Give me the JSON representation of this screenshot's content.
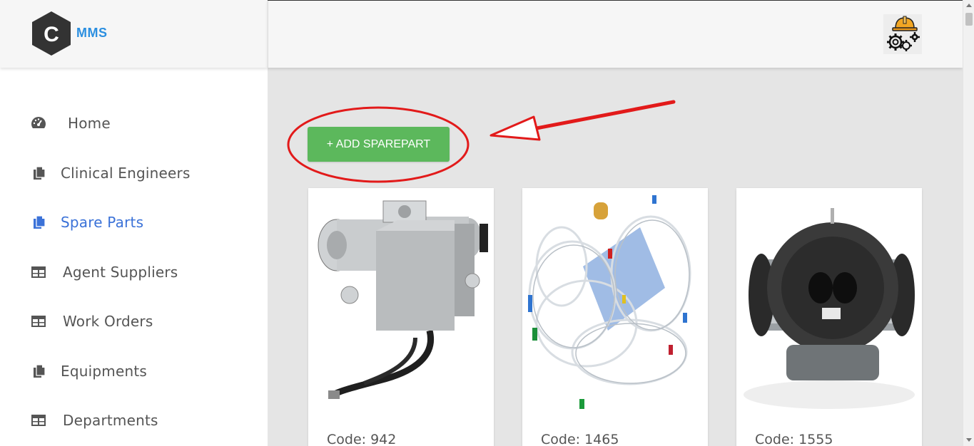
{
  "brand": {
    "text": "MMS",
    "logo_icon": "hexagon-c-logo"
  },
  "sidebar": {
    "items": [
      {
        "label": "Home",
        "icon": "dashboard-icon",
        "active": false
      },
      {
        "label": "Clinical Engineers",
        "icon": "files-icon",
        "active": false
      },
      {
        "label": "Spare Parts",
        "icon": "files-icon",
        "active": true
      },
      {
        "label": "Agent Suppliers",
        "icon": "table-icon",
        "active": false
      },
      {
        "label": "Work Orders",
        "icon": "table-icon",
        "active": false
      },
      {
        "label": "Equipments",
        "icon": "files-icon",
        "active": false
      },
      {
        "label": "Departments",
        "icon": "table-icon",
        "active": false
      }
    ]
  },
  "topbar": {
    "profile_icon": "engineer-gear-icon"
  },
  "main": {
    "add_button_label": "+ ADD SPAREPART",
    "cards": [
      {
        "code": "Code: 942",
        "image_icon": "vacuum-pump-image"
      },
      {
        "code": "Code: 1465",
        "image_icon": "tubing-set-image"
      },
      {
        "code": "Code: 1555",
        "image_icon": "optical-adapter-image"
      }
    ]
  },
  "colors": {
    "accent": "#3b72d8",
    "brand_text": "#2b8fe0",
    "add_button": "#5cb85c",
    "annotation": "#e21a1a",
    "content_bg": "#e5e5e5"
  }
}
